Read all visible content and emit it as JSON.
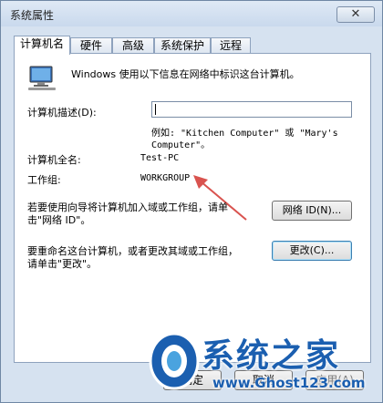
{
  "window": {
    "title": "系统属性",
    "close_symbol": "✕"
  },
  "tabs": [
    "计算机名",
    "硬件",
    "高级",
    "系统保护",
    "远程"
  ],
  "intro": "Windows 使用以下信息在网络中标识这台计算机。",
  "description": {
    "label": "计算机描述(D):",
    "value": "",
    "example_line1": "例如: \"Kitchen Computer\" 或 \"Mary's",
    "example_line2": "Computer\"。"
  },
  "full_name": {
    "label": "计算机全名:",
    "value": "Test-PC"
  },
  "workgroup": {
    "label": "工作组:",
    "value": "WORKGROUP"
  },
  "network_id": {
    "text_line1": "若要使用向导将计算机加入域或工作组，请单",
    "text_line2": "击\"网络 ID\"。",
    "button": "网络 ID(N)..."
  },
  "rename": {
    "text_line1": "要重命名这台计算机，或者更改其域或工作组，",
    "text_line2": "请单击\"更改\"。",
    "button": "更改(C)..."
  },
  "footer": {
    "ok": "确定",
    "cancel": "取消",
    "apply": "应用(A)"
  },
  "watermark": {
    "text": "系统之家",
    "url": "www.Ghost123.com"
  },
  "colors": {
    "arrow": "#d9534f",
    "accent": "#1b5fb0"
  }
}
